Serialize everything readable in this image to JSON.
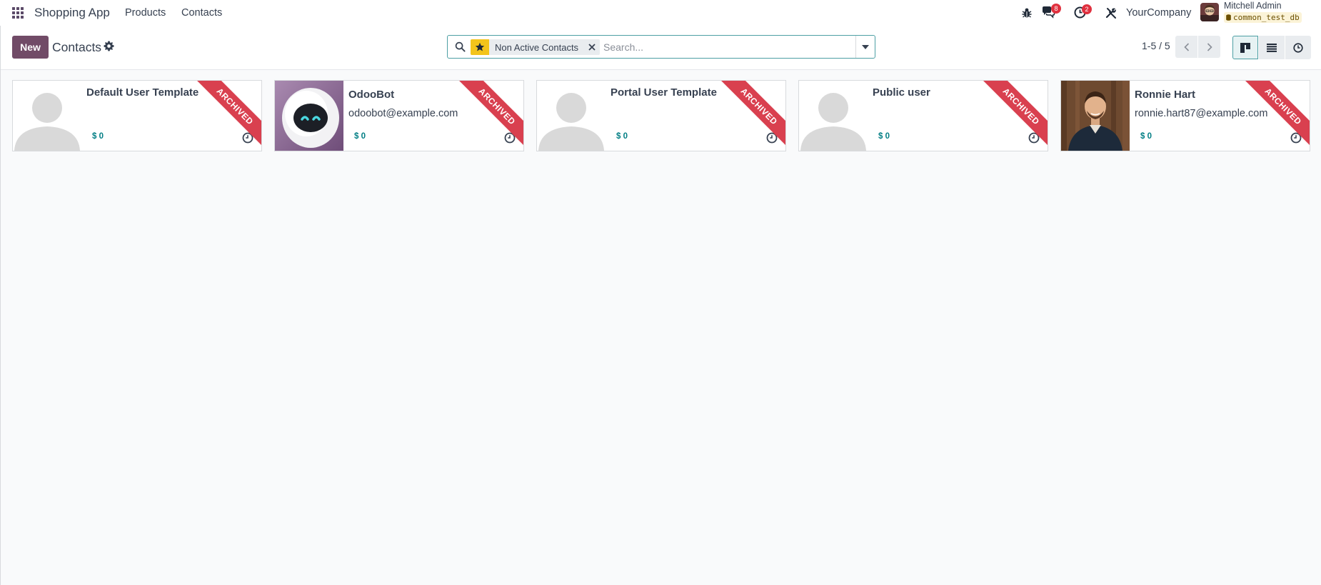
{
  "navbar": {
    "app_name": "Shopping App",
    "menu": [
      "Products",
      "Contacts"
    ],
    "messages_count": "8",
    "activities_count": "2",
    "company": "YourCompany",
    "user_name": "Mitchell Admin",
    "database": "common_test_db",
    "icons": [
      "apps-grid-icon",
      "debug-bug-icon",
      "chat-icon",
      "clock-icon",
      "tools-icon",
      "database-icon"
    ]
  },
  "control_panel": {
    "new_label": "New",
    "title": "Contacts",
    "search": {
      "facet_label": "Non Active Contacts",
      "placeholder": "Search..."
    },
    "pager": "1-5 / 5",
    "views": [
      "kanban",
      "list",
      "activity"
    ],
    "active_view": "kanban"
  },
  "contacts": [
    {
      "name": "Default User Template",
      "email": "",
      "amount": "$ 0",
      "ribbon": "ARCHIVED",
      "avatar": "placeholder"
    },
    {
      "name": "OdooBot",
      "email": "odoobot@example.com",
      "amount": "$ 0",
      "ribbon": "ARCHIVED",
      "avatar": "robot"
    },
    {
      "name": "Portal User Template",
      "email": "",
      "amount": "$ 0",
      "ribbon": "ARCHIVED",
      "avatar": "placeholder"
    },
    {
      "name": "Public user",
      "email": "",
      "amount": "$ 0",
      "ribbon": "ARCHIVED",
      "avatar": "placeholder"
    },
    {
      "name": "Ronnie Hart",
      "email": "ronnie.hart87@example.com",
      "amount": "$ 0",
      "ribbon": "ARCHIVED",
      "avatar": "photo"
    }
  ],
  "colors": {
    "brand": "#714b67",
    "accent": "#017e84",
    "ribbon": "#d9404f",
    "badge": "#e0313f",
    "facet_star": "#f3c41b"
  }
}
